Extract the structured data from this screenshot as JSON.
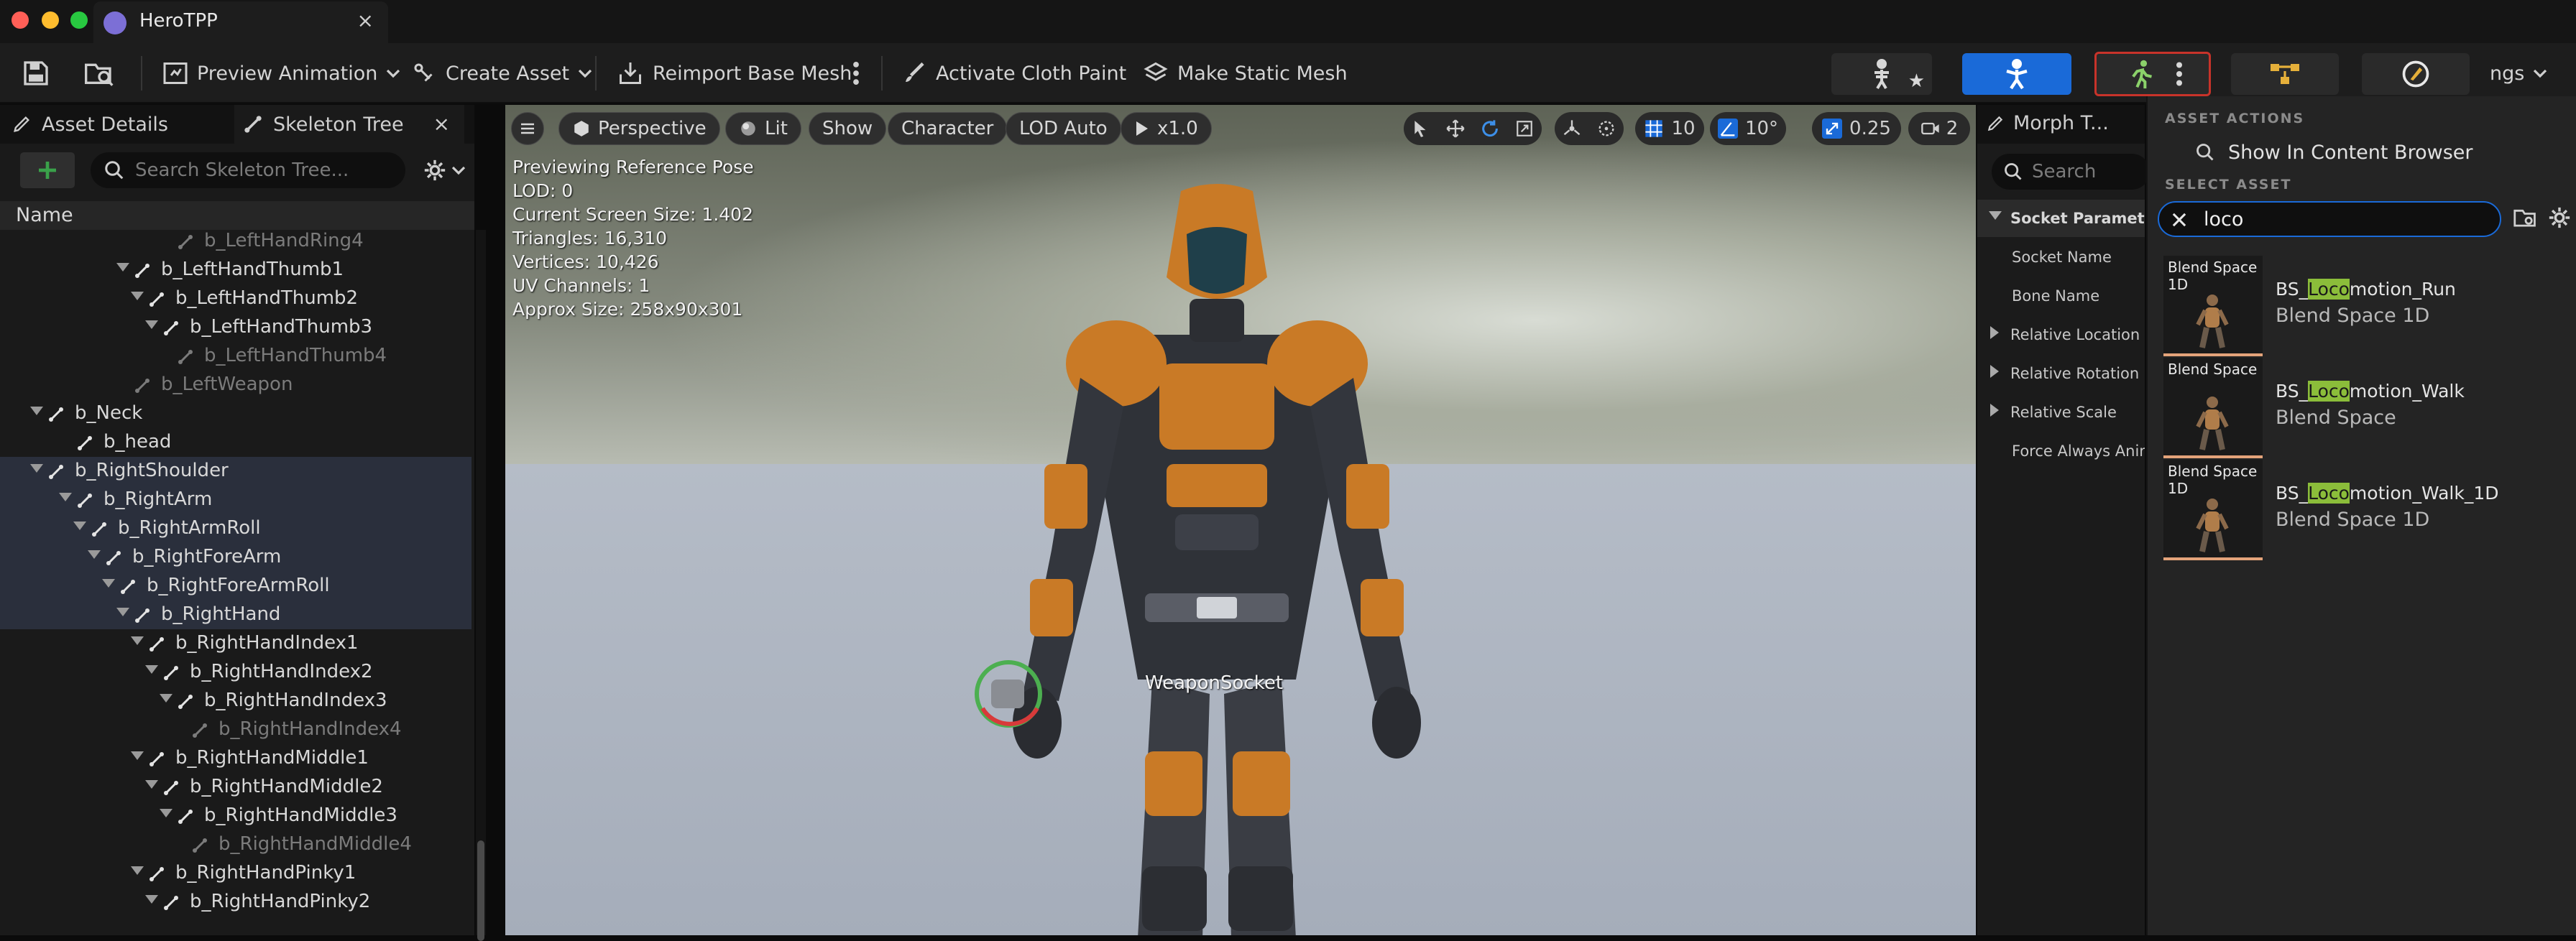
{
  "window": {
    "tab_title": "HeroTPP",
    "close_glyph": "×",
    "traffic_lights": [
      "#ff5f57",
      "#febc2e",
      "#28c840"
    ]
  },
  "toolbar": {
    "preview_animation": "Preview Animation",
    "create_asset": "Create Asset",
    "reimport": "Reimport Base Mesh",
    "cloth_paint": "Activate Cloth Paint",
    "static_mesh": "Make Static Mesh",
    "settings_partial": "ngs"
  },
  "left_panel": {
    "tab_asset_details": "Asset Details",
    "tab_skeleton_tree": "Skeleton Tree",
    "search_placeholder": "Search Skeleton Tree...",
    "column_name": "Name",
    "rows": [
      {
        "label": "b_LeftHandRing4",
        "dim": true
      },
      {
        "label": "b_LeftHandThumb1",
        "dim": false
      },
      {
        "label": "b_LeftHandThumb2",
        "dim": false
      },
      {
        "label": "b_LeftHandThumb3",
        "dim": false
      },
      {
        "label": "b_LeftHandThumb4",
        "dim": true
      },
      {
        "label": "b_LeftWeapon",
        "dim": true
      },
      {
        "label": "b_Neck",
        "dim": false
      },
      {
        "label": "b_head",
        "dim": false
      },
      {
        "label": "b_RightShoulder",
        "dim": false
      },
      {
        "label": "b_RightArm",
        "dim": false
      },
      {
        "label": "b_RightArmRoll",
        "dim": false
      },
      {
        "label": "b_RightForeArm",
        "dim": false
      },
      {
        "label": "b_RightForeArmRoll",
        "dim": false
      },
      {
        "label": "b_RightHand",
        "dim": false
      },
      {
        "label": "b_RightHandIndex1",
        "dim": false
      },
      {
        "label": "b_RightHandIndex2",
        "dim": false
      },
      {
        "label": "b_RightHandIndex3",
        "dim": false
      },
      {
        "label": "b_RightHandIndex4",
        "dim": true
      },
      {
        "label": "b_RightHandMiddle1",
        "dim": false
      },
      {
        "label": "b_RightHandMiddle2",
        "dim": false
      },
      {
        "label": "b_RightHandMiddle3",
        "dim": false
      },
      {
        "label": "b_RightHandMiddle4",
        "dim": true
      },
      {
        "label": "b_RightHandPinky1",
        "dim": false
      },
      {
        "label": "b_RightHandPinky2",
        "dim": false
      }
    ]
  },
  "viewport": {
    "perspective": "Perspective",
    "lit": "Lit",
    "show": "Show",
    "character": "Character",
    "lod": "LOD Auto",
    "speed": "x1.0",
    "grid_snap": "10",
    "rot_snap": "10°",
    "scale_snap": "0.25",
    "camera_speed": "2",
    "info": [
      "Previewing Reference Pose",
      "LOD: 0",
      "Current Screen Size: 1.402",
      "Triangles: 16,310",
      "Vertices: 10,426",
      "UV Channels: 1",
      "Approx Size: 258x90x301"
    ],
    "socket_label": "WeaponSocket"
  },
  "details_panel": {
    "tab": "Morph T...",
    "search_placeholder": "Search",
    "section": "Socket Parameters",
    "rows": [
      "Socket Name",
      "Bone Name",
      "Relative Location",
      "Relative Rotation",
      "Relative Scale",
      "Force Always Anim"
    ]
  },
  "asset_popup": {
    "actions_header": "ASSET ACTIONS",
    "show_in_browser": "Show In Content Browser",
    "select_header": "SELECT ASSET",
    "search_value": "loco",
    "results": [
      {
        "thumb_type": "Blend Space 1D",
        "pre": "BS_",
        "match": "Loco",
        "post": "motion_Run",
        "type": "Blend Space 1D"
      },
      {
        "thumb_type": "Blend Space",
        "pre": "BS_",
        "match": "Loco",
        "post": "motion_Walk",
        "type": "Blend Space"
      },
      {
        "thumb_type": "Blend Space 1D",
        "pre": "BS_",
        "match": "Loco",
        "post": "motion_Walk_1D",
        "type": "Blend Space 1D"
      }
    ]
  },
  "colors": {
    "accent_blue": "#1a6ad8",
    "highlight_border": "#c8332a",
    "search_match": "#8bbd3a",
    "add_green": "#3aa14a"
  }
}
